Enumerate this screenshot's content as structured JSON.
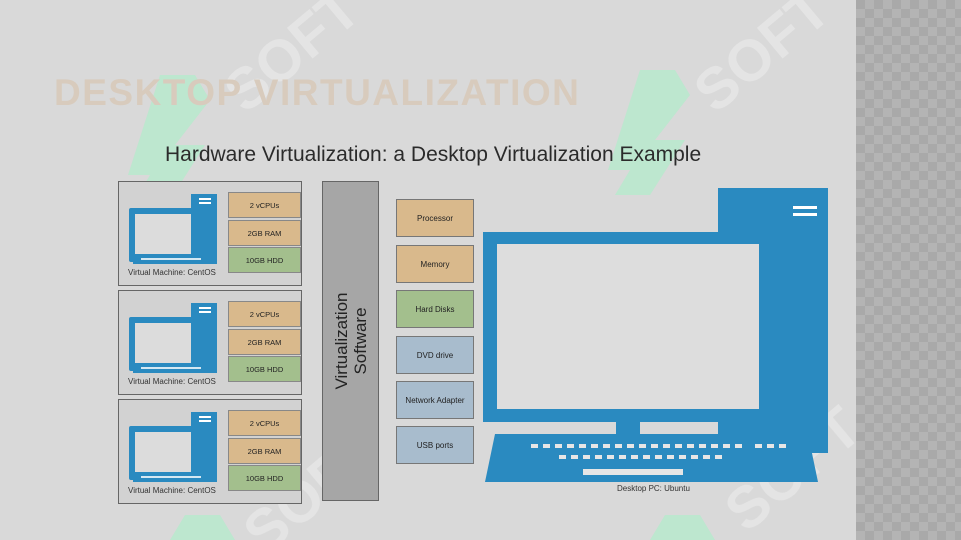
{
  "slide": {
    "title": "DESKTOP VIRTUALIZATION",
    "watermark_text": "SOFT",
    "colors": {
      "background": "#d9d9d9",
      "accent_blue": "#2a8ac0",
      "tan": "#d9b98c",
      "green": "#a3bf8d",
      "light_blue": "#a8bccd"
    }
  },
  "diagram": {
    "title": "Hardware Virtualization: a Desktop Virtualization Example",
    "virtual_machines": [
      {
        "caption": "Virtual Machine: CentOS",
        "resources": [
          "2 vCPUs",
          "2GB RAM",
          "10GB HDD"
        ]
      },
      {
        "caption": "Virtual Machine: CentOS",
        "resources": [
          "2 vCPUs",
          "2GB RAM",
          "10GB HDD"
        ]
      },
      {
        "caption": "Virtual Machine: CentOS",
        "resources": [
          "2 vCPUs",
          "2GB RAM",
          "10GB HDD"
        ]
      }
    ],
    "virtualization_layer": {
      "line1": "Virtualization",
      "line2": "Software"
    },
    "hardware_components": [
      "Processor",
      "Memory",
      "Hard Disks",
      "DVD drive",
      "Network Adapter",
      "USB ports"
    ],
    "desktop_caption": "Desktop PC: Ubuntu"
  }
}
